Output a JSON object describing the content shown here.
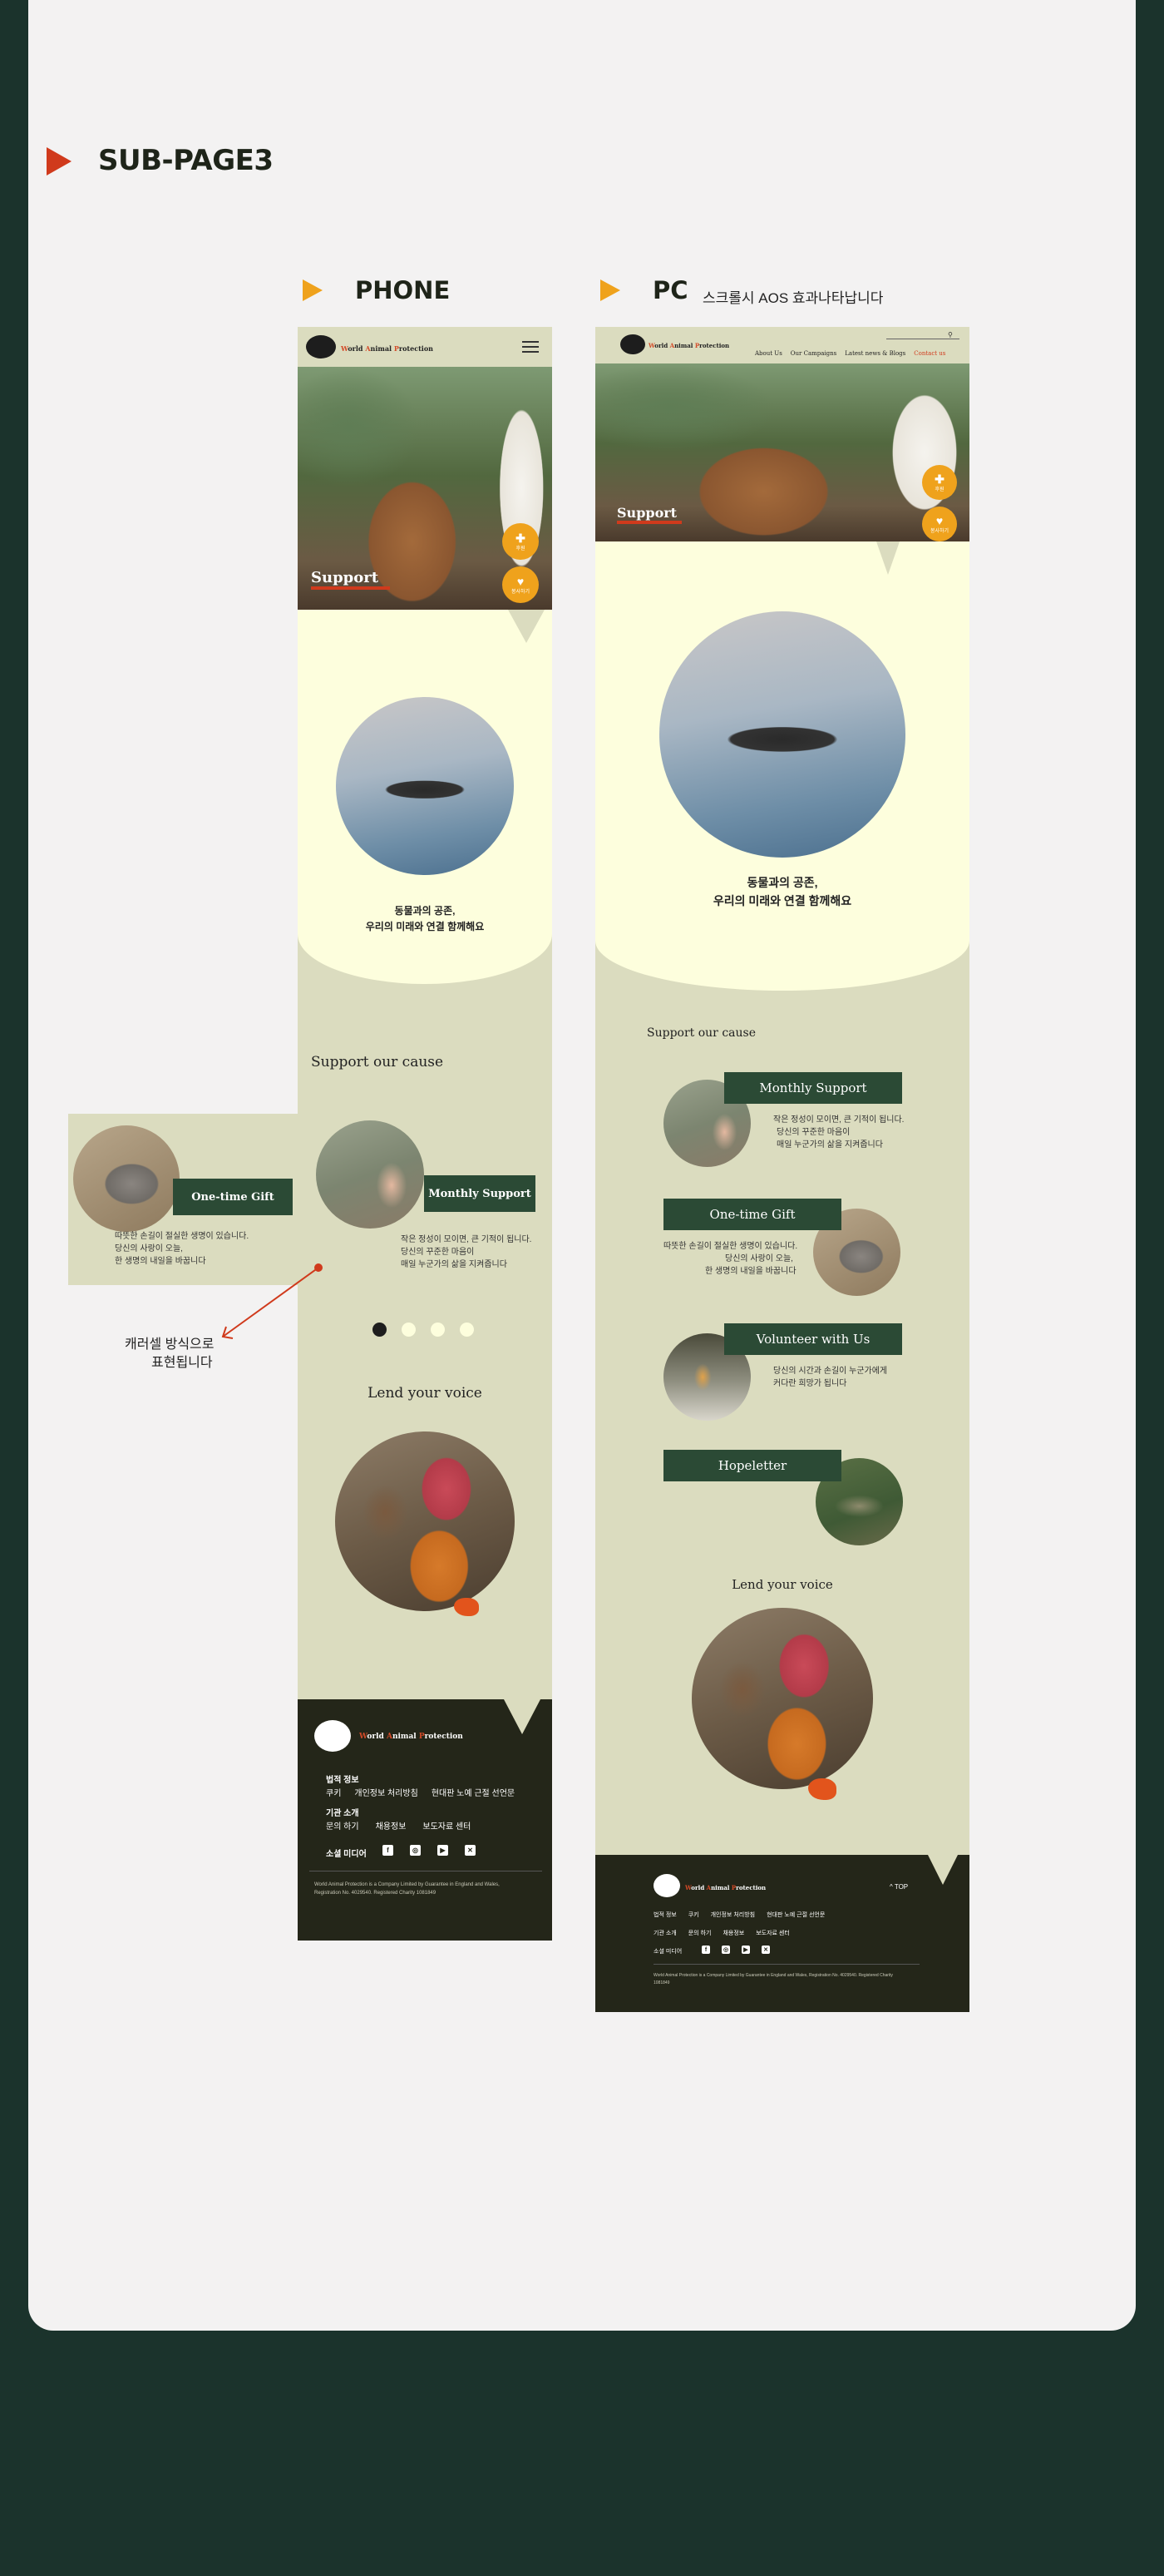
{
  "section_title": "SUB-PAGE3",
  "phone_heading": "PHONE",
  "pc_heading": "PC",
  "pc_note": "스크롤시 AOS 효과나타납니다",
  "annotation": {
    "line1": "캐러셀 방식으로",
    "line2": "표현됩니다"
  },
  "brand": {
    "logo_text": "World Animal Protection",
    "logo_w": "W",
    "logo_orld": "orld ",
    "logo_a": "A",
    "logo_nimal": "nimal ",
    "logo_p": "P",
    "logo_rotection": "rotection"
  },
  "pc_nav": [
    "About Us",
    "Our Campaigns",
    "Latest news & Blogs",
    "Contact us"
  ],
  "hero_title": "Support",
  "side_buttons": [
    {
      "icon": "donate-icon",
      "label": "후원"
    },
    {
      "icon": "heart-icon",
      "label": "봉사하기"
    }
  ],
  "intro": {
    "line1": "동물과의 공존,",
    "line2": "우리의 미래와 연결 함께해요"
  },
  "cause_title": "Support our cause",
  "cards": [
    {
      "label": "Monthly Support",
      "desc": [
        "작은 정성이 모이면, 큰 기적이 됩니다.",
        "당신의 꾸준한 마음이",
        "매일 누군가의 삶을 지켜줍니다"
      ]
    },
    {
      "label": "One-time Gift",
      "desc": [
        "따뜻한 손길이 절실한 생명이 있습니다.",
        "당신의 사랑이 오늘,",
        "한 생명의 내일을 바꿉니다"
      ]
    },
    {
      "label": "Volunteer with Us",
      "desc": [
        "당신의 시간과 손길이 누군가에게",
        "커다란 희망가 됩니다"
      ]
    },
    {
      "label": "Hopeletter",
      "desc": []
    }
  ],
  "voice_title": "Lend your voice",
  "footer": {
    "legal_title": "법적 정보",
    "legal_links": [
      "쿠키",
      "개인정보 처리방침",
      "현대판 노예 근절 선언문"
    ],
    "org_title": "기관 소개",
    "org_links": [
      "문의 하기",
      "채용정보",
      "보도자료 센터"
    ],
    "social_title": "소셜 미디어",
    "social_icons": [
      "facebook-icon",
      "instagram-icon",
      "youtube-icon",
      "x-icon"
    ],
    "copyright": "World Animal Protection is a Company Limited by Guarantee in England and Wales, Registration No. 4029540. Registered Charity 1081849",
    "top_label": "TOP"
  },
  "colors": {
    "accent": "#d03a1c",
    "orange": "#efa21c",
    "cream": "#fdfedd",
    "olive": "#dbdcbf",
    "green": "#2b4a35",
    "dark": "#242619",
    "bg": "#1b332c"
  }
}
